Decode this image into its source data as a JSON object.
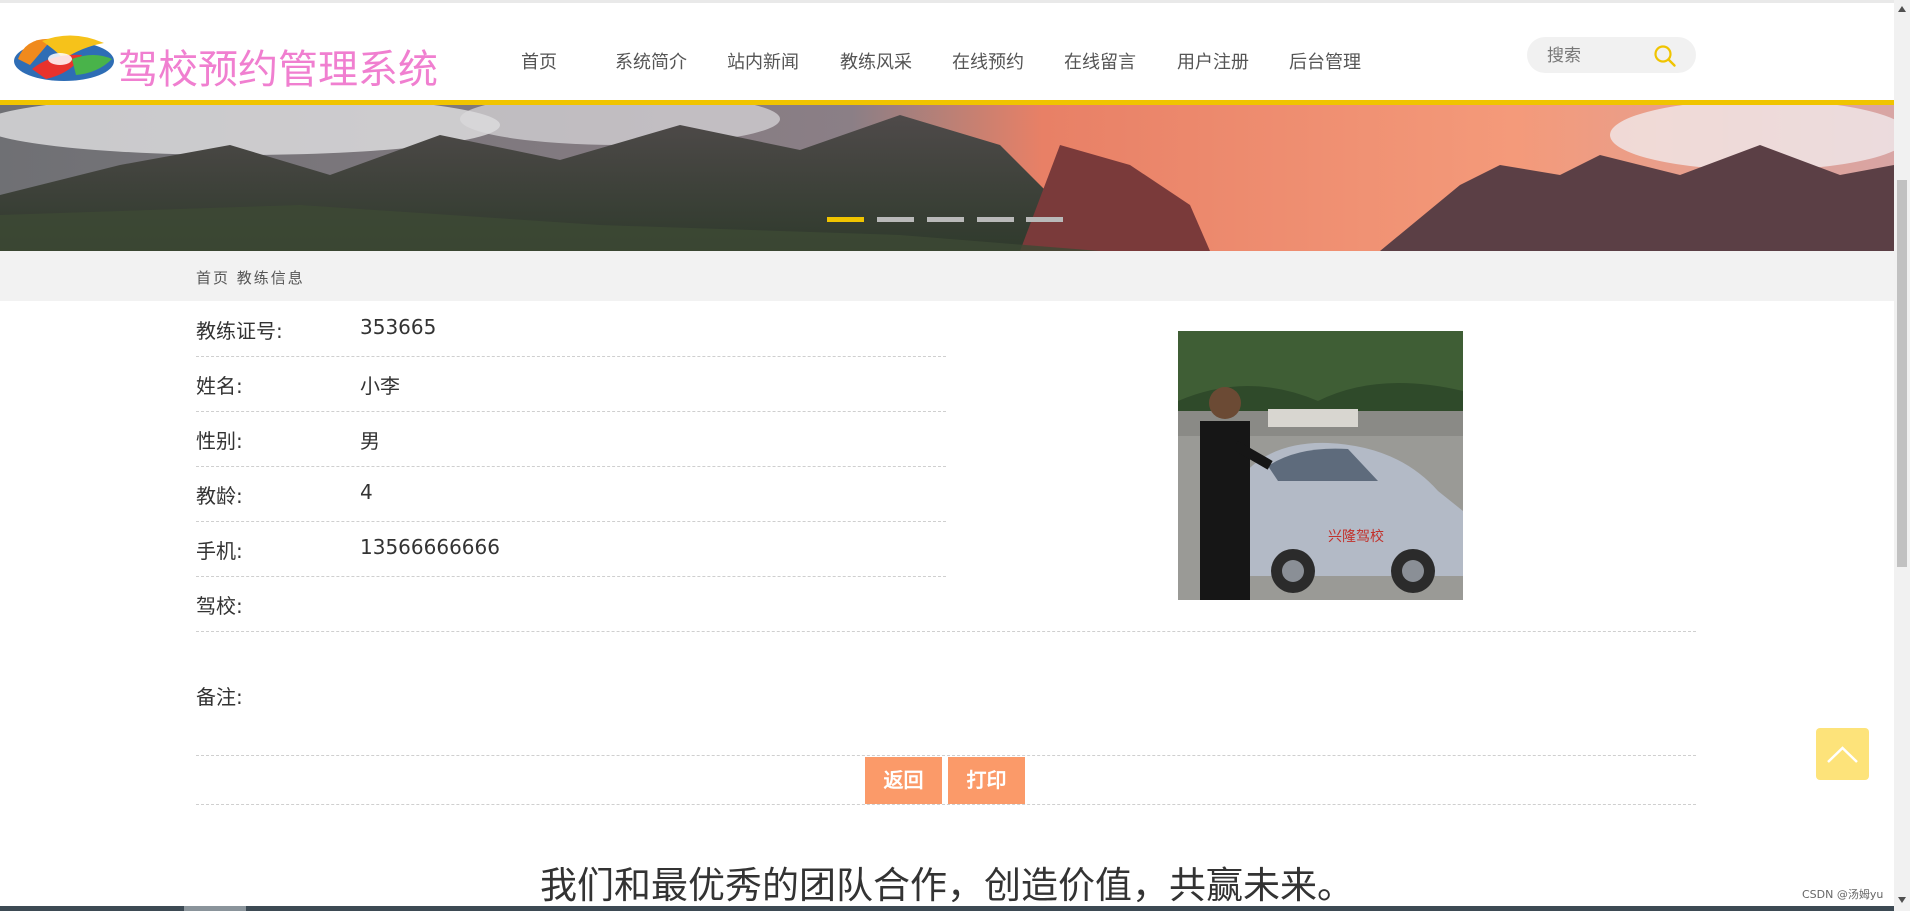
{
  "header": {
    "site_title": "驾校预约管理系统",
    "nav": [
      "首页",
      "系统简介",
      "站内新闻",
      "教练风采",
      "在线预约",
      "在线留言",
      "用户注册",
      "后台管理"
    ],
    "search_placeholder": "搜索",
    "accent_color": "#f0c400",
    "title_color": "#f07fd0"
  },
  "banner": {
    "slide_count": 5,
    "active_slide": 1
  },
  "breadcrumb": {
    "home": "首页",
    "current": "教练信息"
  },
  "coach": {
    "fields": [
      {
        "label": "教练证号:",
        "value": "353665"
      },
      {
        "label": "姓名:",
        "value": "小李"
      },
      {
        "label": "性别:",
        "value": "男"
      },
      {
        "label": "教龄:",
        "value": "4"
      },
      {
        "label": "手机:",
        "value": "13566666666"
      },
      {
        "label": "驾校:",
        "value": ""
      }
    ],
    "remark_label": "备注:",
    "remark_value": "",
    "car_text": "兴隆驾校"
  },
  "actions": {
    "back_label": "返回",
    "print_label": "打印",
    "button_color": "#fb9a69"
  },
  "footer": {
    "slogan": "我们和最优秀的团队合作，创造价值，共赢未来。"
  },
  "watermark": "CSDN @汤姆yu"
}
